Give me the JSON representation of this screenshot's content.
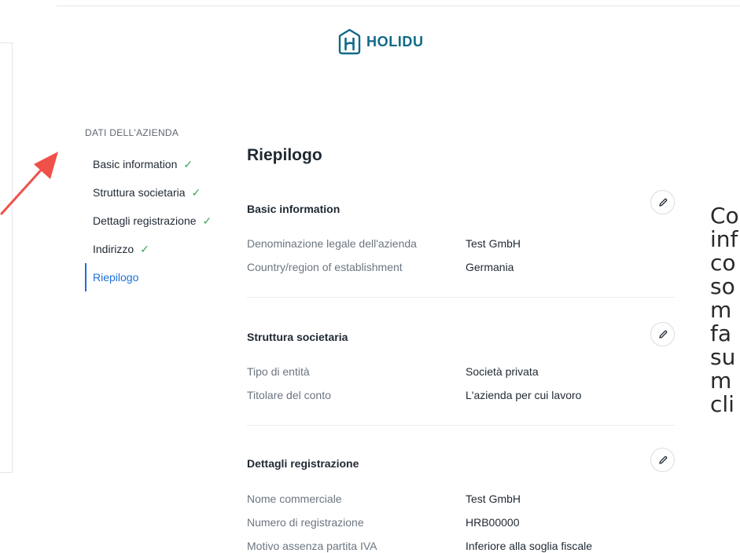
{
  "brand": {
    "name": "HOLIDU",
    "color": "#0f6a87"
  },
  "nav": {
    "heading": "DATI DELL'AZIENDA",
    "items": [
      {
        "label": "Basic information",
        "done": true,
        "check": "✓"
      },
      {
        "label": "Struttura societaria",
        "done": true,
        "check": "✓"
      },
      {
        "label": "Dettagli registrazione",
        "done": true,
        "check": "✓"
      },
      {
        "label": "Indirizzo",
        "done": true,
        "check": "✓"
      },
      {
        "label": "Riepilogo",
        "done": false,
        "active": true
      }
    ]
  },
  "summary": {
    "title": "Riepilogo",
    "sections": [
      {
        "title": "Basic information",
        "rows": [
          {
            "label": "Denominazione legale dell'azienda",
            "value": "Test GmbH"
          },
          {
            "label": "Country/region of establishment",
            "value": "Germania"
          }
        ]
      },
      {
        "title": "Struttura societaria",
        "rows": [
          {
            "label": "Tipo di entità",
            "value": "Società privata"
          },
          {
            "label": "Titolare del conto",
            "value": "L'azienda per cui lavoro"
          }
        ]
      },
      {
        "title": "Dettagli registrazione",
        "rows": [
          {
            "label": "Nome commerciale",
            "value": "Test GmbH"
          },
          {
            "label": "Numero di registrazione",
            "value": "HRB00000"
          },
          {
            "label": "Motivo assenza partita IVA",
            "value": "Inferiore alla soglia fiscale"
          }
        ]
      }
    ]
  },
  "side_text": "Co\ninf\nco\nso\nm\nfa\nsu\nm\ncli",
  "annotation_arrow_color": "#f0504a"
}
